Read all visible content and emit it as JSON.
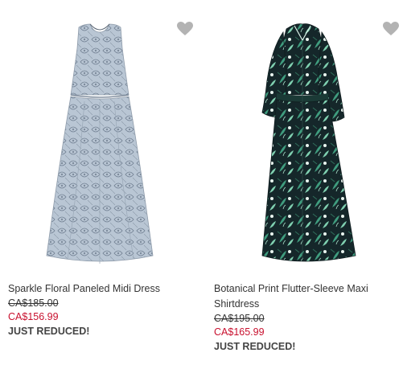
{
  "colors": {
    "sale_price": "#c8102e",
    "wishlist_icon": "#b3b3b3",
    "text": "#333333"
  },
  "products": [
    {
      "name": "Sparkle Floral Paneled Midi Dress",
      "original_price": "CA$185.00",
      "sale_price": "CA$156.99",
      "badge": "JUST REDUCED!",
      "image": "light blue sleeveless lace midi dress",
      "wishlist_icon": "heart-icon"
    },
    {
      "name": "Botanical Print Flutter-Sleeve Maxi Shirtdress",
      "original_price": "CA$195.00",
      "sale_price": "CA$165.99",
      "badge": "JUST REDUCED!",
      "image": "dark green botanical print maxi shirtdress",
      "wishlist_icon": "heart-icon"
    }
  ]
}
